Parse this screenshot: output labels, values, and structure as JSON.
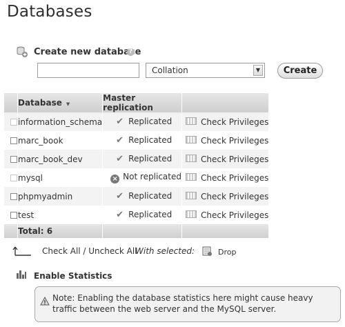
{
  "page": {
    "title": "Databases"
  },
  "create": {
    "title": "Create new database",
    "help": "?",
    "name_value": "",
    "collation_value": "Collation",
    "create_label": "Create"
  },
  "table": {
    "headers": {
      "database": "Database",
      "replication": "Master replication"
    },
    "rows": [
      {
        "name": "information_schema",
        "replication": "Replicated",
        "replicated": true,
        "privileges": "Check Privileges",
        "checkbox_enabled": false
      },
      {
        "name": "marc_book",
        "replication": "Replicated",
        "replicated": true,
        "privileges": "Check Privileges",
        "checkbox_enabled": true
      },
      {
        "name": "marc_book_dev",
        "replication": "Replicated",
        "replicated": true,
        "privileges": "Check Privileges",
        "checkbox_enabled": true
      },
      {
        "name": "mysql",
        "replication": "Not replicated",
        "replicated": false,
        "privileges": "Check Privileges",
        "checkbox_enabled": false
      },
      {
        "name": "phpmyadmin",
        "replication": "Replicated",
        "replicated": true,
        "privileges": "Check Privileges",
        "checkbox_enabled": true
      },
      {
        "name": "test",
        "replication": "Replicated",
        "replicated": true,
        "privileges": "Check Privileges",
        "checkbox_enabled": true
      }
    ],
    "total": "Total: 6"
  },
  "actions": {
    "check_all": "Check All / Uncheck All",
    "with_selected": "With selected:",
    "drop": "Drop"
  },
  "stats": {
    "enable_label": "Enable Statistics",
    "note": "Note: Enabling the database statistics here might cause heavy traffic between the web server and the MySQL server."
  },
  "icons": {
    "create_db": "database-add-icon",
    "help": "help-icon",
    "replicated": "check-icon",
    "not_replicated": "x-circle-icon",
    "privileges": "privileges-icon",
    "check_all_arrow": "arrow-up-icon",
    "drop": "drop-icon",
    "stats": "bar-chart-icon",
    "warning": "warning-icon"
  }
}
